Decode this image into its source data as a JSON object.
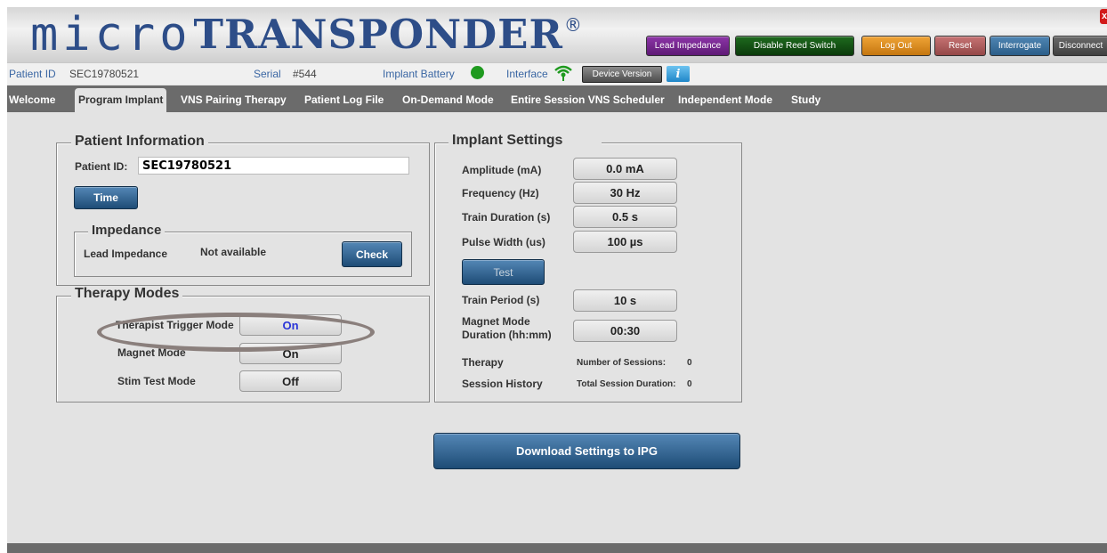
{
  "app": {
    "logo_micro": "micro",
    "logo_transponder": "TRANSPONDER",
    "logo_reg": "®",
    "close_label": "x"
  },
  "header_buttons": {
    "lead_impedance": "Lead Impedance",
    "disable_reed": "Disable Reed Switch",
    "log_out": "Log Out",
    "reset": "Reset",
    "interrogate": "Interrogate",
    "disconnect": "Disconnect"
  },
  "infobar": {
    "patient_id_label": "Patient ID",
    "patient_id_value": "SEC19780521",
    "serial_label": "Serial",
    "serial_value": "#544",
    "battery_label": "Implant Battery",
    "interface_label": "Interface",
    "device_version": "Device Version",
    "info_icon": "i",
    "battery_color": "#1f9a1f",
    "interface_icon": "wifi-signal-icon"
  },
  "tabs": [
    {
      "label": "Welcome"
    },
    {
      "label": "Program Implant"
    },
    {
      "label": "VNS Pairing Therapy"
    },
    {
      "label": "Patient Log File"
    },
    {
      "label": "On-Demand Mode"
    },
    {
      "label": "Entire Session VNS Scheduler"
    },
    {
      "label": "Independent Mode"
    },
    {
      "label": "Study"
    }
  ],
  "patient_info": {
    "title": "Patient Information",
    "id_label": "Patient ID:",
    "id_value": "SEC19780521",
    "time_button": "Time"
  },
  "impedance": {
    "title": "Impedance",
    "label": "Lead Impedance",
    "value": "Not available",
    "check_button": "Check"
  },
  "therapy_modes": {
    "title": "Therapy Modes",
    "rows": [
      {
        "label": "Therapist Trigger Mode",
        "value": "On"
      },
      {
        "label": "Magnet Mode",
        "value": "On"
      },
      {
        "label": "Stim Test Mode",
        "value": "Off"
      }
    ]
  },
  "implant_settings": {
    "title": "Implant Settings",
    "amplitude_label": "Amplitude (mA)",
    "amplitude_value": "0.0 mA",
    "frequency_label": "Frequency (Hz)",
    "frequency_value": "30 Hz",
    "train_duration_label": "Train Duration (s)",
    "train_duration_value": "0.5 s",
    "pulse_width_label": "Pulse Width (us)",
    "pulse_width_value": "100 µs",
    "test_button": "Test",
    "train_period_label": "Train Period (s)",
    "train_period_value": "10 s",
    "magnet_duration_label_1": "Magnet Mode",
    "magnet_duration_label_2": "Duration (hh:mm)",
    "magnet_duration_value": "00:30",
    "therapy_label": "Therapy",
    "sessions_label": "Number of Sessions:",
    "sessions_value": "0",
    "history_label": "Session History",
    "total_duration_label": "Total Session Duration:",
    "total_duration_value": "0"
  },
  "download_button": "Download Settings to IPG"
}
